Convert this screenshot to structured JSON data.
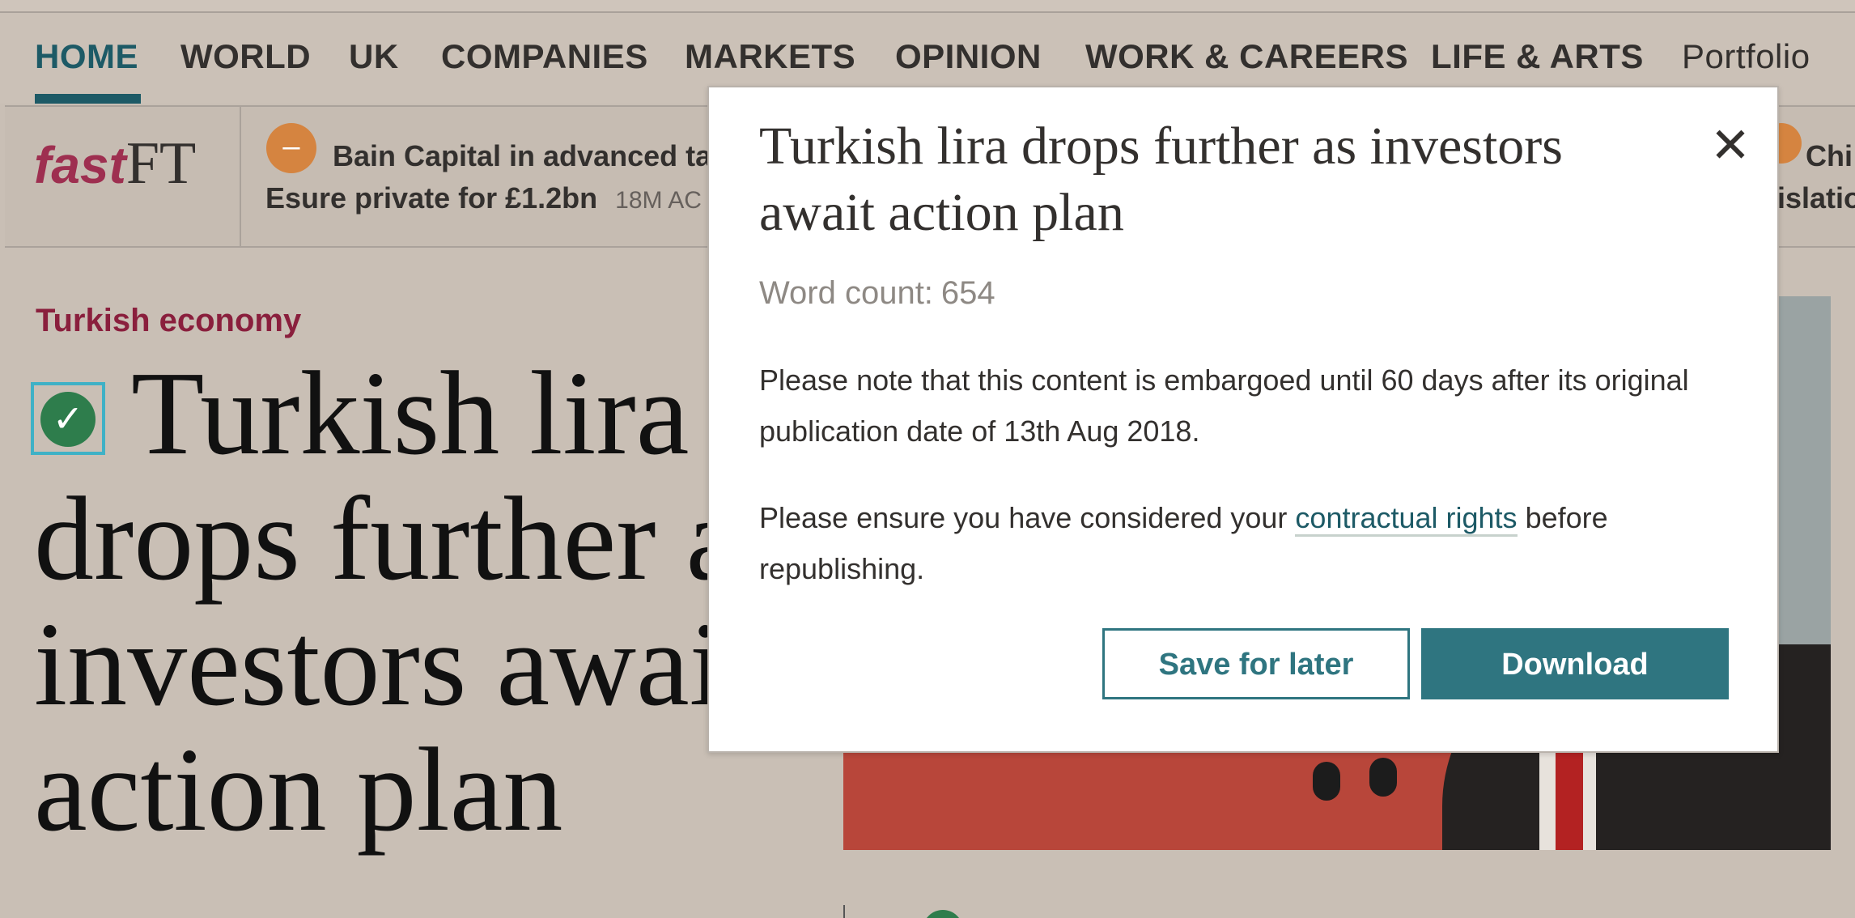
{
  "nav": {
    "items": [
      "HOME",
      "WORLD",
      "UK",
      "COMPANIES",
      "MARKETS",
      "OPINION",
      "WORK & CAREERS",
      "LIFE & ARTS"
    ],
    "portfolio": "Portfolio"
  },
  "strip": {
    "logo_fast": "fast",
    "logo_ft": "FT",
    "ticker_icon": "–",
    "ticker_line1": "Bain Capital in advanced ta",
    "ticker_line2": "Esure private for £1.2bn",
    "ticker_time": "18M AC",
    "right_line1": "Chi",
    "right_line2": "islatio"
  },
  "article": {
    "topic": "Turkish economy",
    "check_icon": "✓",
    "headline": "Turkish lira drops further as investors await action plan"
  },
  "modal": {
    "title": "Turkish lira drops further as investors await action plan",
    "close_icon": "✕",
    "word_count_label": "Word count:",
    "word_count_value": "654",
    "notice": "Please note that this content is embargoed until 60 days after its original publication date of 13th Aug 2018.",
    "rights_prefix": "Please ensure you have considered your ",
    "rights_link": "contractual rights",
    "rights_suffix": " before republishing.",
    "save_label": "Save for later",
    "download_label": "Download"
  },
  "colors": {
    "accent": "#2f7580",
    "nav_active": "#1d5a66",
    "topic": "#8a1f3d",
    "ticker_dot": "#d58440"
  }
}
